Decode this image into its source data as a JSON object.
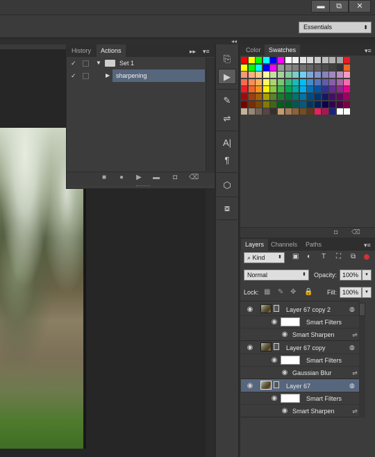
{
  "window": {
    "controls": [
      "▬",
      "⧉",
      "✕"
    ],
    "workspace": "Essentials"
  },
  "actions_panel": {
    "tabs": [
      "History",
      "Actions"
    ],
    "collapse_glyph": "▸▸",
    "menu_glyph": "▾≡",
    "set_name": "Set 1",
    "action_name": "sharpening",
    "bottom_icons": [
      "stop-icon",
      "record-icon",
      "play-icon",
      "folder-icon",
      "new-action-icon",
      "delete-icon"
    ]
  },
  "toolbar": {
    "icons": [
      "history-brush-tool-icon",
      "actions-play-icon",
      "brush-presets-icon",
      "adjustments-icon",
      "character-icon",
      "paragraph-icon",
      "3d-icon",
      "3d-materials-icon"
    ]
  },
  "swatches_panel": {
    "tabs": [
      "Color",
      "Swatches"
    ],
    "rows": [
      [
        "#ff0000",
        "#ffff00",
        "#00ff00",
        "#00ffff",
        "#0000ff",
        "#ff00ff",
        "#ffffff",
        "#f2f2f2",
        "#e6e6e6",
        "#d9d9d9",
        "#cccccc",
        "#bfbfbf",
        "#b3b3b3",
        "#a6a6a6",
        "#ed1c24"
      ],
      [
        "#ffff00",
        "#00ff00",
        "#00ffff",
        "#0000ff",
        "#ff00ff",
        "#999999",
        "#8c8c8c",
        "#808080",
        "#737373",
        "#666666",
        "#595959",
        "#4d4d4d",
        "#404040",
        "#333333",
        "#f26522"
      ],
      [
        "#f7977a",
        "#f9ad81",
        "#fdc68a",
        "#fff79a",
        "#c4df9b",
        "#a2d39c",
        "#82ca9d",
        "#7bcdc8",
        "#6ecff6",
        "#7ea7d8",
        "#8493ca",
        "#8882be",
        "#a187be",
        "#bc8dbf",
        "#f49ac2"
      ],
      [
        "#f26c4f",
        "#f68e55",
        "#fbaf5c",
        "#fff467",
        "#acd372",
        "#7cc576",
        "#3bb878",
        "#1abbb4",
        "#00bff3",
        "#438cca",
        "#5574b9",
        "#605ca8",
        "#855fa8",
        "#a763a8",
        "#f06eaa"
      ],
      [
        "#ed1c24",
        "#f26522",
        "#f7941d",
        "#fff200",
        "#8dc73f",
        "#39b54a",
        "#00a651",
        "#00a99d",
        "#00aeef",
        "#0072bc",
        "#0054a6",
        "#2e3192",
        "#662d91",
        "#92278f",
        "#ec008c"
      ],
      [
        "#9e0b0f",
        "#a0410d",
        "#a3620a",
        "#aba000",
        "#598527",
        "#1a7b30",
        "#007236",
        "#00746b",
        "#0076a3",
        "#004b80",
        "#003471",
        "#1b1464",
        "#440e62",
        "#630460",
        "#9e005d"
      ],
      [
        "#790000",
        "#7b2e00",
        "#7d4900",
        "#827b00",
        "#406618",
        "#005e20",
        "#005826",
        "#005952",
        "#005b7f",
        "#003663",
        "#002157",
        "#0d004c",
        "#32004b",
        "#4b0049",
        "#7b0046"
      ],
      [
        "#c7b299",
        "#998675",
        "#736357",
        "#534741",
        "#37302d",
        "#c69c6d",
        "#a67c52",
        "#8c6239",
        "#754c24",
        "#603913",
        "#e91e63",
        "#ad1457",
        "#1a237e",
        "#ffffff",
        "#ffffff"
      ]
    ]
  },
  "layers_panel": {
    "tabs": [
      "Layers",
      "Channels",
      "Paths"
    ],
    "filter": "Kind",
    "blend_mode": "Normal",
    "opacity_label": "Opacity:",
    "opacity_value": "100%",
    "lock_label": "Lock:",
    "fill_label": "Fill:",
    "fill_value": "100%",
    "layers": [
      {
        "name": "Layer 67 copy 2",
        "filters_label": "Smart Filters",
        "filter_name": "Smart Sharpen",
        "selected": false
      },
      {
        "name": "Layer 67 copy",
        "filters_label": "Smart Filters",
        "filter_name": "Gaussian Blur",
        "selected": false
      },
      {
        "name": "Layer 67",
        "filters_label": "Smart Filters",
        "filter_name": "Smart Sharpen",
        "selected": true
      }
    ]
  },
  "colors": {
    "panel_bg": "#3c3c3c",
    "selection": "#56667d",
    "app_bg": "#262626"
  }
}
